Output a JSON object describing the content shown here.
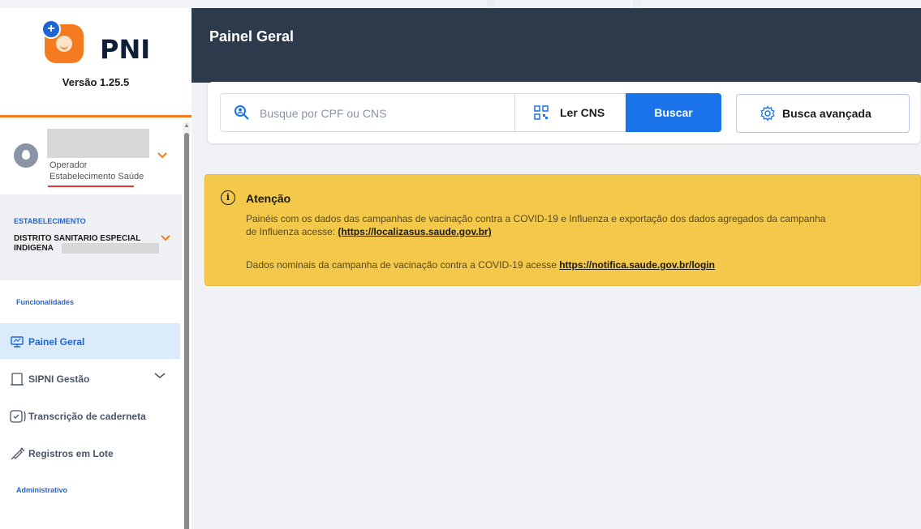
{
  "brand": {
    "name": "PNI",
    "version": "Versão 1.25.5",
    "accent": "#f47b20",
    "primary": "#1a73e8"
  },
  "user": {
    "role": "Operador",
    "establishment_type": "Estabelecimento Saúde"
  },
  "establishment": {
    "label": "ESTABELECIMENTO",
    "name_line1": "DISTRITO SANITARIO ESPECIAL",
    "name_line2": "INDIGENA"
  },
  "sidebar": {
    "section_funcionalidades": "Funcionalidades",
    "section_administrativo": "Administrativo",
    "items": [
      {
        "label": "Painel Geral",
        "icon": "monitor-icon",
        "active": true
      },
      {
        "label": "SIPNI Gestão",
        "icon": "document-icon",
        "active": false
      },
      {
        "label": "Transcrição de caderneta",
        "icon": "checklist-icon",
        "active": false
      },
      {
        "label": "Registros em Lote",
        "icon": "syringe-icon",
        "active": false
      }
    ]
  },
  "header": {
    "title": "Painel Geral"
  },
  "search": {
    "placeholder": "Busque por CPF ou CNS",
    "read_cns_label": "Ler CNS",
    "search_button": "Buscar",
    "advanced_button": "Busca avançada"
  },
  "alert": {
    "title": "Atenção",
    "line1": "Painéis com os dados das campanhas de vacinação contra a COVID-19 e Influenza e exportação dos dados agregados da campanha",
    "line2_prefix": "de Influenza acesse: ",
    "line2_link": "(https://localizasus.saude.gov.br)",
    "line3_prefix": "Dados nominais da campanha de vacinação contra a COVID-19 acesse ",
    "line3_link": "https://notifica.saude.gov.br/login"
  }
}
